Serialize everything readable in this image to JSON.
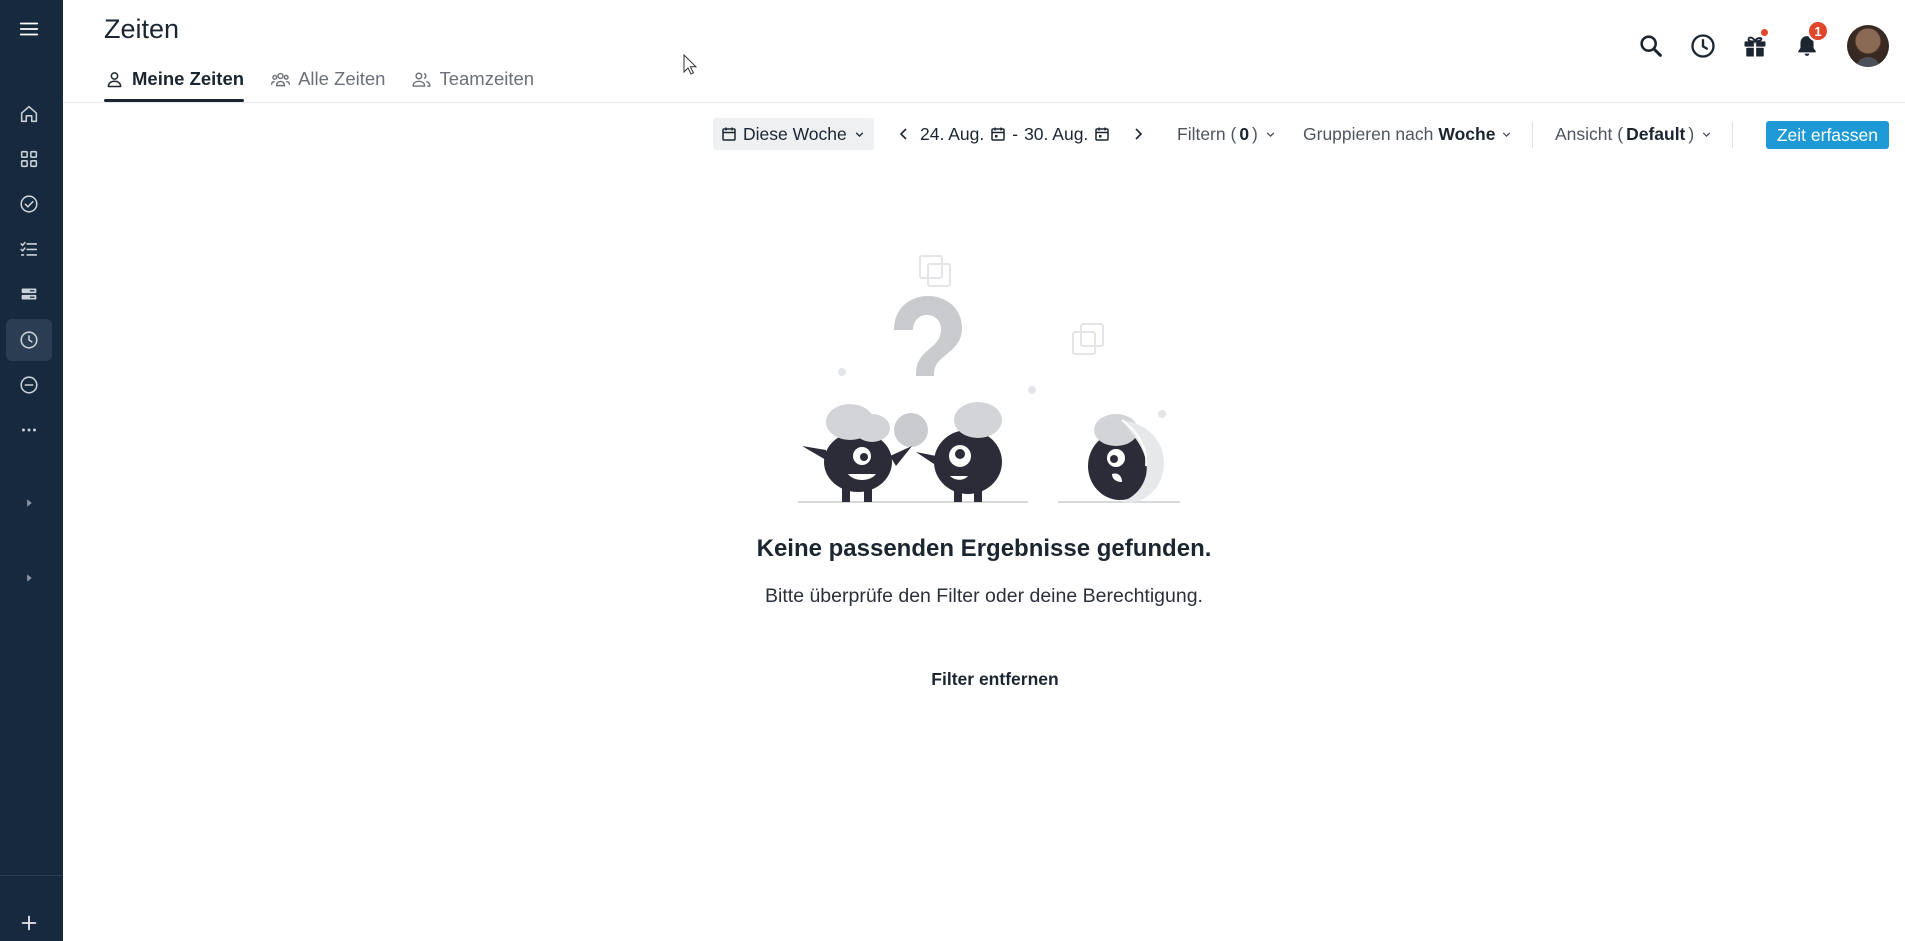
{
  "page": {
    "title": "Zeiten",
    "tabs": [
      {
        "label": "Meine Zeiten",
        "icon": "user-icon",
        "active": true
      },
      {
        "label": "Alle Zeiten",
        "icon": "users-group-icon",
        "active": false
      },
      {
        "label": "Teamzeiten",
        "icon": "users-icon",
        "active": false
      }
    ]
  },
  "header": {
    "notification_count": "1"
  },
  "toolbar": {
    "period_label": "Diese Woche",
    "date_from": "24. Aug.",
    "date_separator": "-",
    "date_to": "30. Aug.",
    "filter_label": "Filtern (",
    "filter_count": "0",
    "filter_suffix": ")",
    "group_label": "Gruppieren nach",
    "group_value": "Woche",
    "view_label": "Ansicht (",
    "view_value": "Default",
    "view_suffix": ")",
    "cta_label": "Zeit erfassen"
  },
  "empty_state": {
    "title": "Keine passenden Ergebnisse gefunden.",
    "subtitle": "Bitte überprüfe den Filter oder deine Berechtigung.",
    "action_label": "Filter entfernen"
  },
  "colors": {
    "sidebar_bg": "#17293c",
    "accent": "#1d9ad6",
    "badge": "#e0462b"
  }
}
